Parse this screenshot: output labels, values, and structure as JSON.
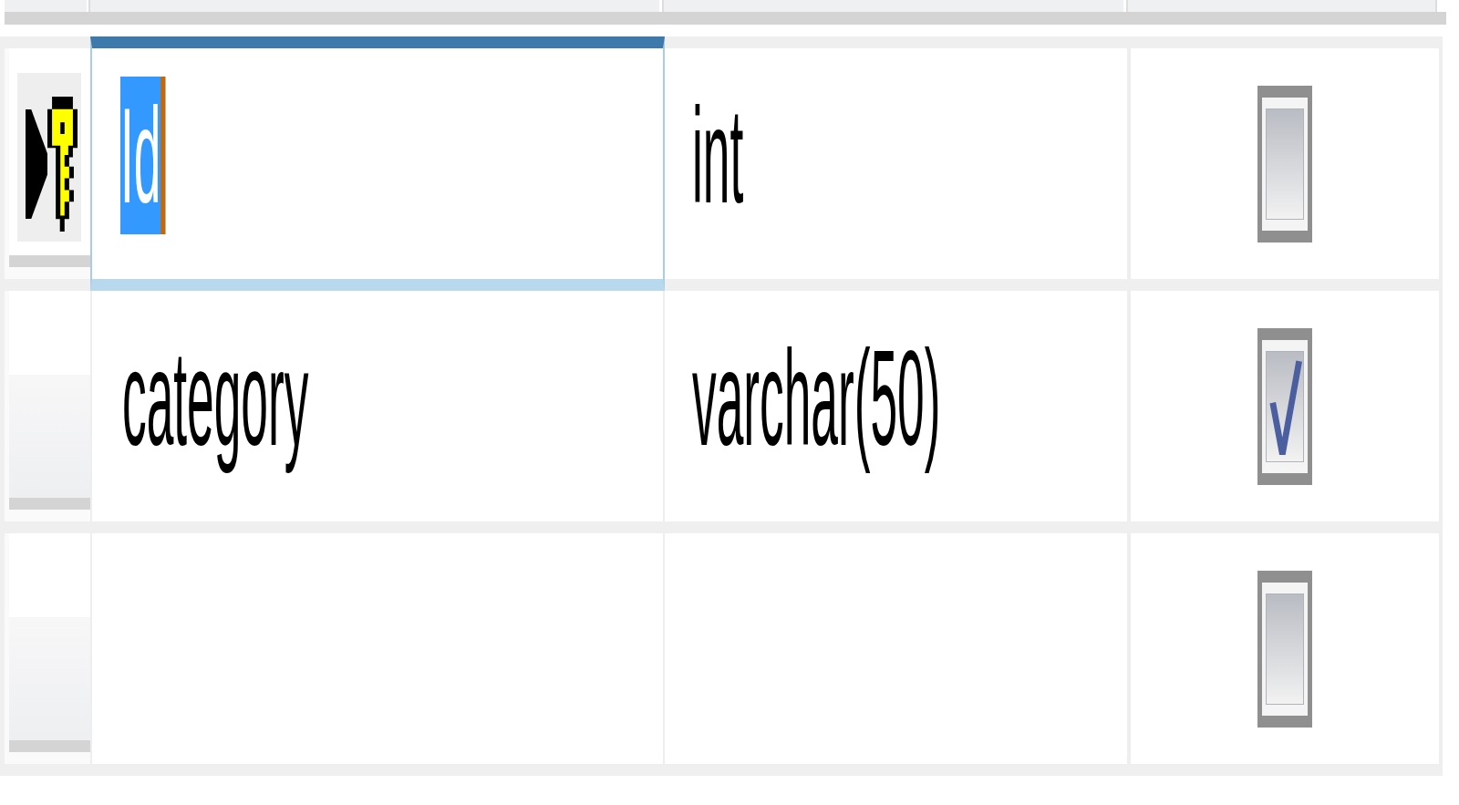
{
  "table": {
    "rows": [
      {
        "current": true,
        "primary_key": true,
        "selected": true,
        "column_name": "Id",
        "data_type": "int",
        "allow_nulls": false
      },
      {
        "current": false,
        "primary_key": false,
        "selected": false,
        "column_name": "category",
        "data_type": "varchar(50)",
        "allow_nulls": true
      },
      {
        "current": false,
        "primary_key": false,
        "selected": false,
        "allow_nulls": false
      }
    ]
  }
}
